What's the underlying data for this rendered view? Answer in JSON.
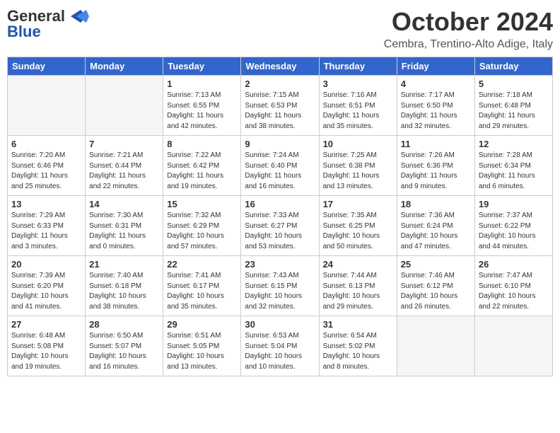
{
  "header": {
    "logo_general": "General",
    "logo_blue": "Blue",
    "month_title": "October 2024",
    "location": "Cembra, Trentino-Alto Adige, Italy"
  },
  "days_of_week": [
    "Sunday",
    "Monday",
    "Tuesday",
    "Wednesday",
    "Thursday",
    "Friday",
    "Saturday"
  ],
  "weeks": [
    [
      {
        "day": "",
        "info": ""
      },
      {
        "day": "",
        "info": ""
      },
      {
        "day": "1",
        "info": "Sunrise: 7:13 AM\nSunset: 6:55 PM\nDaylight: 11 hours and 42 minutes."
      },
      {
        "day": "2",
        "info": "Sunrise: 7:15 AM\nSunset: 6:53 PM\nDaylight: 11 hours and 38 minutes."
      },
      {
        "day": "3",
        "info": "Sunrise: 7:16 AM\nSunset: 6:51 PM\nDaylight: 11 hours and 35 minutes."
      },
      {
        "day": "4",
        "info": "Sunrise: 7:17 AM\nSunset: 6:50 PM\nDaylight: 11 hours and 32 minutes."
      },
      {
        "day": "5",
        "info": "Sunrise: 7:18 AM\nSunset: 6:48 PM\nDaylight: 11 hours and 29 minutes."
      }
    ],
    [
      {
        "day": "6",
        "info": "Sunrise: 7:20 AM\nSunset: 6:46 PM\nDaylight: 11 hours and 25 minutes."
      },
      {
        "day": "7",
        "info": "Sunrise: 7:21 AM\nSunset: 6:44 PM\nDaylight: 11 hours and 22 minutes."
      },
      {
        "day": "8",
        "info": "Sunrise: 7:22 AM\nSunset: 6:42 PM\nDaylight: 11 hours and 19 minutes."
      },
      {
        "day": "9",
        "info": "Sunrise: 7:24 AM\nSunset: 6:40 PM\nDaylight: 11 hours and 16 minutes."
      },
      {
        "day": "10",
        "info": "Sunrise: 7:25 AM\nSunset: 6:38 PM\nDaylight: 11 hours and 13 minutes."
      },
      {
        "day": "11",
        "info": "Sunrise: 7:26 AM\nSunset: 6:36 PM\nDaylight: 11 hours and 9 minutes."
      },
      {
        "day": "12",
        "info": "Sunrise: 7:28 AM\nSunset: 6:34 PM\nDaylight: 11 hours and 6 minutes."
      }
    ],
    [
      {
        "day": "13",
        "info": "Sunrise: 7:29 AM\nSunset: 6:33 PM\nDaylight: 11 hours and 3 minutes."
      },
      {
        "day": "14",
        "info": "Sunrise: 7:30 AM\nSunset: 6:31 PM\nDaylight: 11 hours and 0 minutes."
      },
      {
        "day": "15",
        "info": "Sunrise: 7:32 AM\nSunset: 6:29 PM\nDaylight: 10 hours and 57 minutes."
      },
      {
        "day": "16",
        "info": "Sunrise: 7:33 AM\nSunset: 6:27 PM\nDaylight: 10 hours and 53 minutes."
      },
      {
        "day": "17",
        "info": "Sunrise: 7:35 AM\nSunset: 6:25 PM\nDaylight: 10 hours and 50 minutes."
      },
      {
        "day": "18",
        "info": "Sunrise: 7:36 AM\nSunset: 6:24 PM\nDaylight: 10 hours and 47 minutes."
      },
      {
        "day": "19",
        "info": "Sunrise: 7:37 AM\nSunset: 6:22 PM\nDaylight: 10 hours and 44 minutes."
      }
    ],
    [
      {
        "day": "20",
        "info": "Sunrise: 7:39 AM\nSunset: 6:20 PM\nDaylight: 10 hours and 41 minutes."
      },
      {
        "day": "21",
        "info": "Sunrise: 7:40 AM\nSunset: 6:18 PM\nDaylight: 10 hours and 38 minutes."
      },
      {
        "day": "22",
        "info": "Sunrise: 7:41 AM\nSunset: 6:17 PM\nDaylight: 10 hours and 35 minutes."
      },
      {
        "day": "23",
        "info": "Sunrise: 7:43 AM\nSunset: 6:15 PM\nDaylight: 10 hours and 32 minutes."
      },
      {
        "day": "24",
        "info": "Sunrise: 7:44 AM\nSunset: 6:13 PM\nDaylight: 10 hours and 29 minutes."
      },
      {
        "day": "25",
        "info": "Sunrise: 7:46 AM\nSunset: 6:12 PM\nDaylight: 10 hours and 26 minutes."
      },
      {
        "day": "26",
        "info": "Sunrise: 7:47 AM\nSunset: 6:10 PM\nDaylight: 10 hours and 22 minutes."
      }
    ],
    [
      {
        "day": "27",
        "info": "Sunrise: 6:48 AM\nSunset: 5:08 PM\nDaylight: 10 hours and 19 minutes."
      },
      {
        "day": "28",
        "info": "Sunrise: 6:50 AM\nSunset: 5:07 PM\nDaylight: 10 hours and 16 minutes."
      },
      {
        "day": "29",
        "info": "Sunrise: 6:51 AM\nSunset: 5:05 PM\nDaylight: 10 hours and 13 minutes."
      },
      {
        "day": "30",
        "info": "Sunrise: 6:53 AM\nSunset: 5:04 PM\nDaylight: 10 hours and 10 minutes."
      },
      {
        "day": "31",
        "info": "Sunrise: 6:54 AM\nSunset: 5:02 PM\nDaylight: 10 hours and 8 minutes."
      },
      {
        "day": "",
        "info": ""
      },
      {
        "day": "",
        "info": ""
      }
    ]
  ]
}
